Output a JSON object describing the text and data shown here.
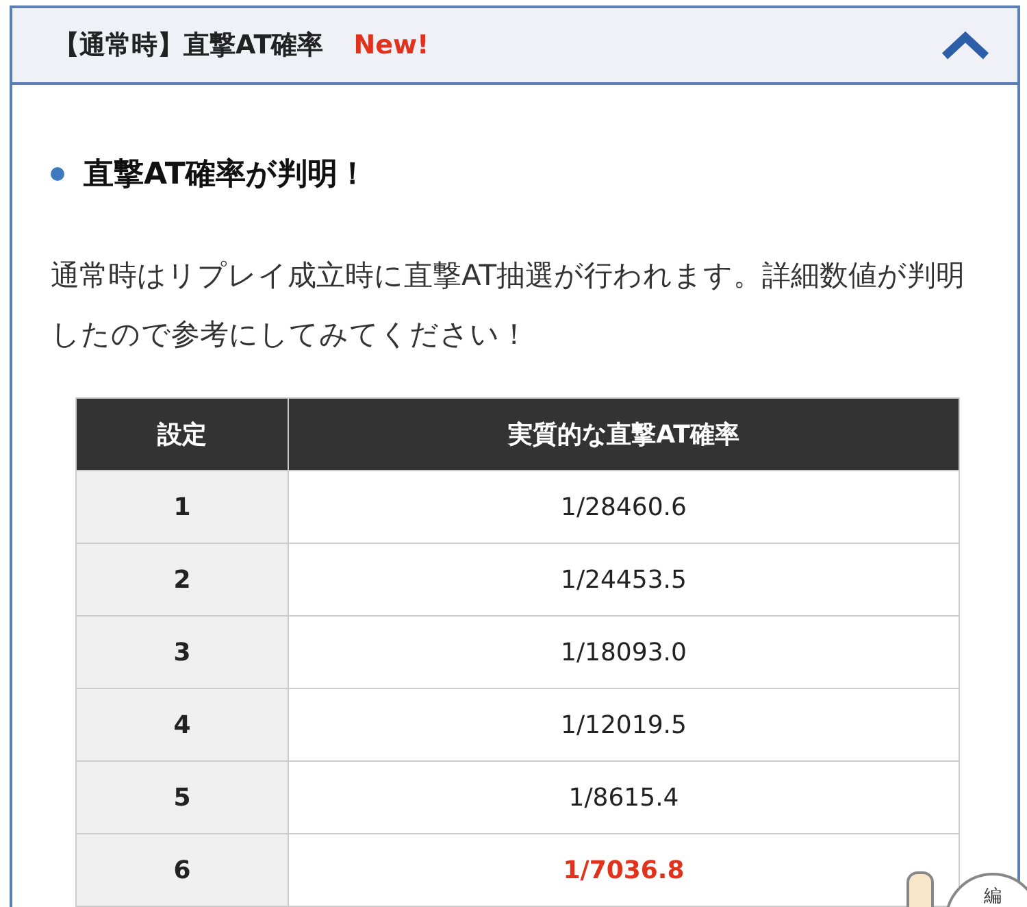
{
  "accordion": {
    "title": "【通常時】直撃AT確率",
    "badge": "New!",
    "expanded": true
  },
  "heading": "直撃AT確率が判明！",
  "paragraph": "通常時はリプレイ成立時に直撃AT抽選が行われます。詳細数値が判明したので参考にしてみてください！",
  "table": {
    "columns": [
      "設定",
      "実質的な直撃AT確率"
    ],
    "rows": [
      {
        "cells": [
          "1",
          "1/28460.6"
        ],
        "highlighted": false
      },
      {
        "cells": [
          "2",
          "1/24453.5"
        ],
        "highlighted": false
      },
      {
        "cells": [
          "3",
          "1/18093.0"
        ],
        "highlighted": false
      },
      {
        "cells": [
          "4",
          "1/12019.5"
        ],
        "highlighted": false
      },
      {
        "cells": [
          "5",
          "1/8615.4"
        ],
        "highlighted": false
      },
      {
        "cells": [
          "6",
          "1/7036.8"
        ],
        "highlighted": true
      }
    ]
  },
  "mascot": {
    "bubble_text": "編"
  }
}
